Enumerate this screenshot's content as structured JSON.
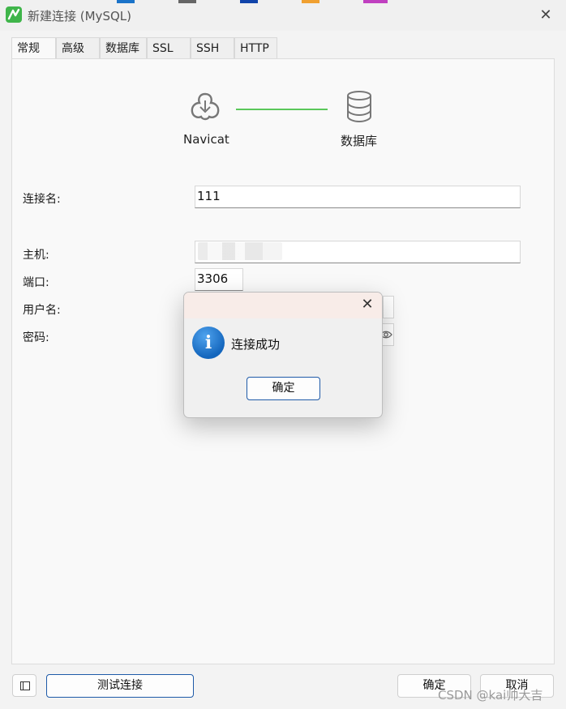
{
  "window": {
    "title": "新建连接 (MySQL)",
    "close_glyph": "✕"
  },
  "tabs": [
    {
      "label": "常规",
      "active": true
    },
    {
      "label": "高级",
      "active": false
    },
    {
      "label": "数据库",
      "active": false
    },
    {
      "label": "SSL",
      "active": false
    },
    {
      "label": "SSH",
      "active": false
    },
    {
      "label": "HTTP",
      "active": false
    }
  ],
  "flow": {
    "left_label": "Navicat",
    "right_label": "数据库",
    "left_icon": "navicat-icon",
    "right_icon": "database-icon",
    "line_color": "#5ac85a"
  },
  "form": {
    "connection_name_label": "连接名:",
    "connection_name_value": "111",
    "host_label": "主机:",
    "port_label": "端口:",
    "port_value": "3306",
    "username_label": "用户名:",
    "password_label": "密码:"
  },
  "footer": {
    "test_button": "测试连接",
    "ok_button": "确定",
    "cancel_button": "取消"
  },
  "dialog": {
    "message": "连接成功",
    "ok_button": "确定",
    "close_glyph": "✕",
    "icon": "info-icon",
    "icon_glyph": "i"
  },
  "watermark": "CSDN @kai帅大吉",
  "colors": {
    "accent": "#1e5aa8",
    "brand": "#3fb54a"
  }
}
